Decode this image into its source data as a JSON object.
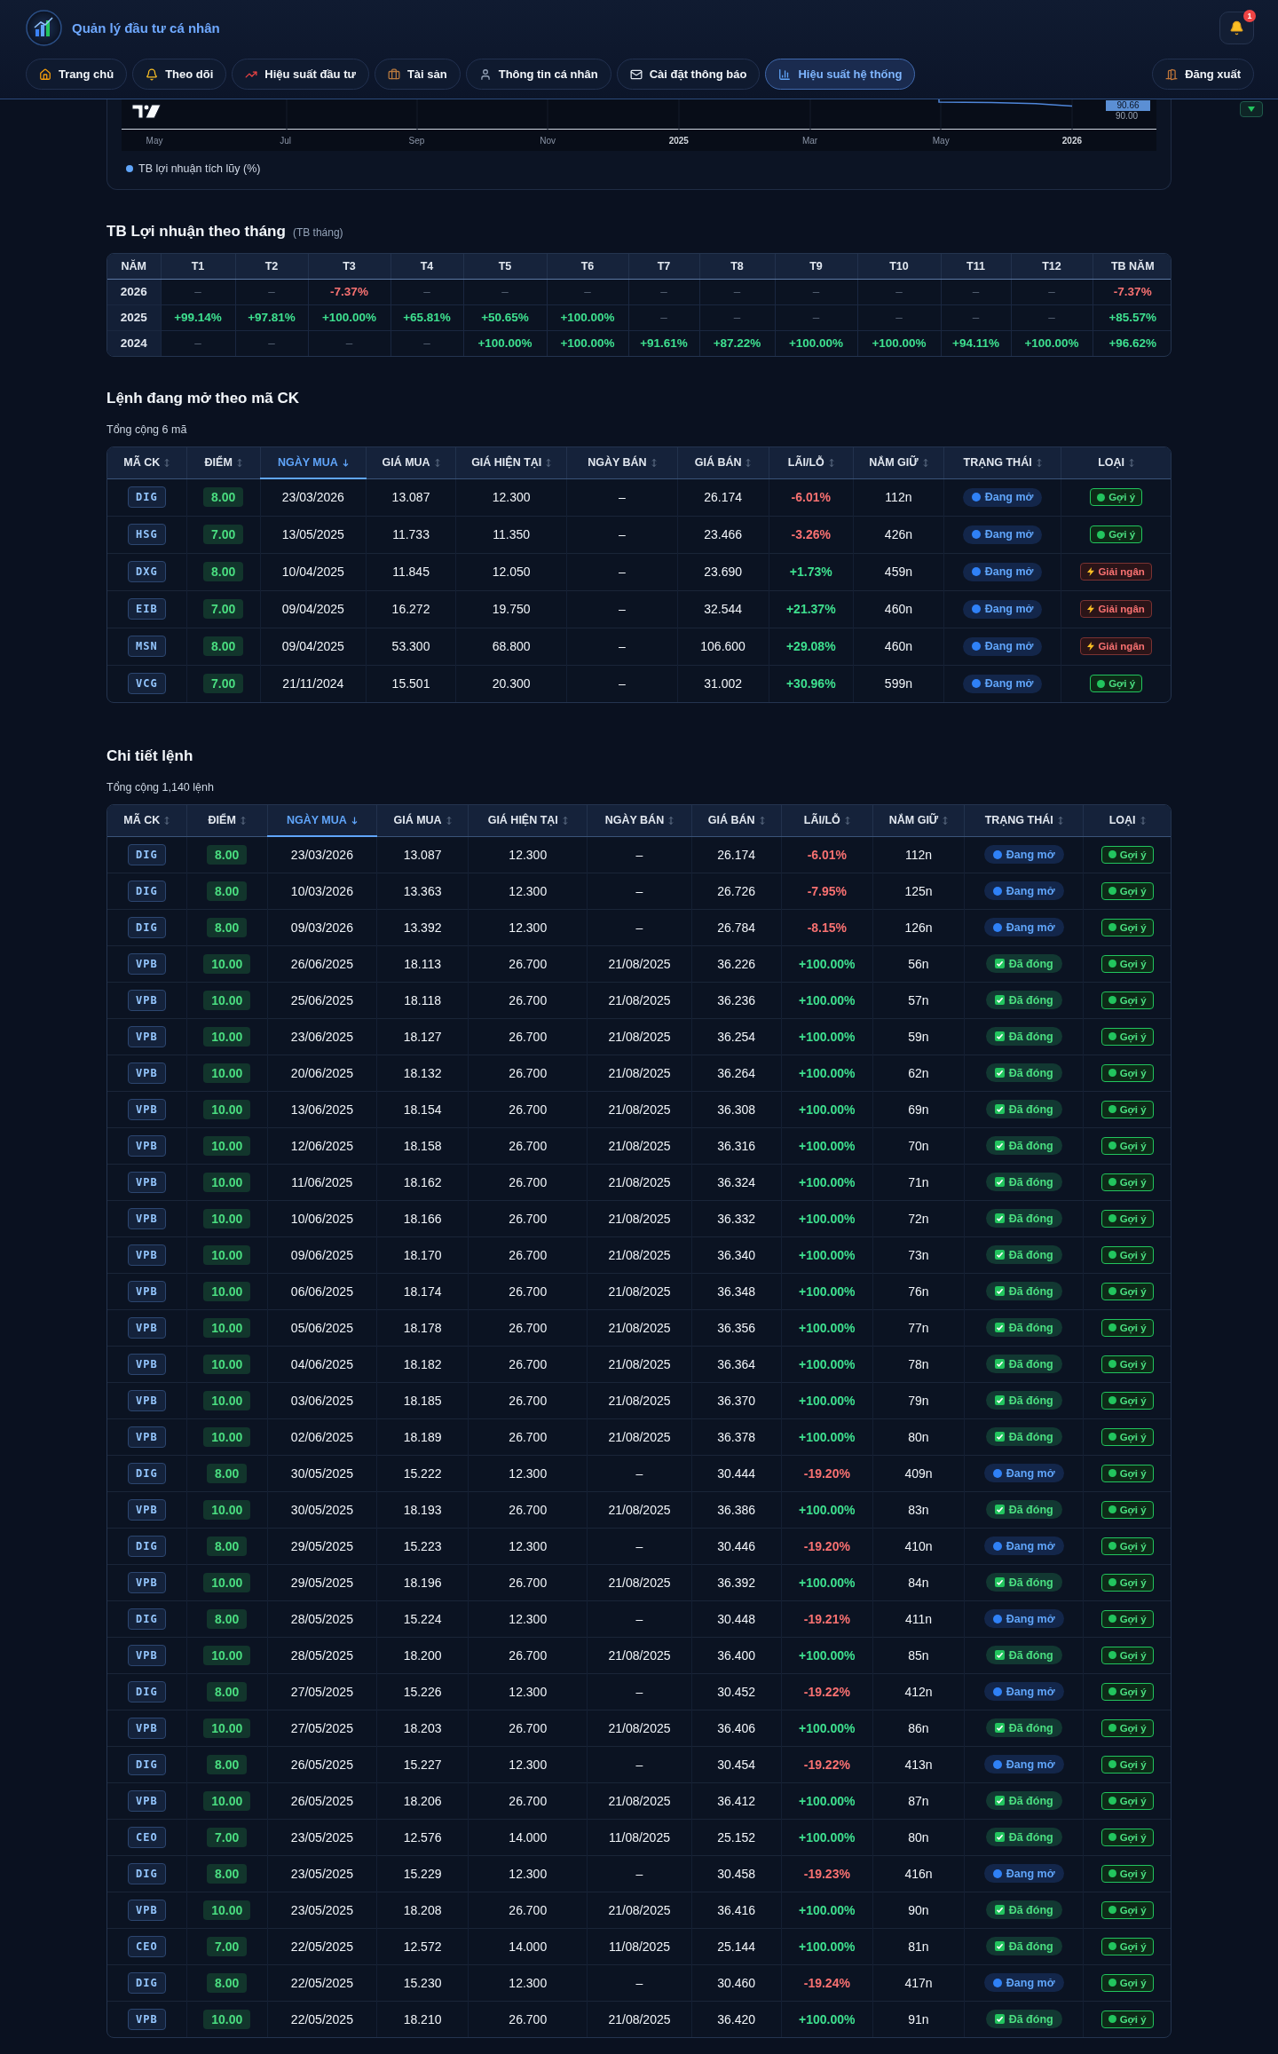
{
  "header": {
    "title": "Quản lý đầu tư cá nhân",
    "notification_count": "1"
  },
  "nav": {
    "tabs": [
      {
        "label": "Trang chủ",
        "selected": false
      },
      {
        "label": "Theo dõi",
        "selected": false
      },
      {
        "label": "Hiệu suất đầu tư",
        "selected": false
      },
      {
        "label": "Tài sản",
        "selected": false
      },
      {
        "label": "Thông tin cá nhân",
        "selected": false
      },
      {
        "label": "Cài đặt thông báo",
        "selected": false
      },
      {
        "label": "Hiệu suất hệ thống",
        "selected": true
      }
    ],
    "logout": "Đăng xuất"
  },
  "chart": {
    "price_label": "90.66",
    "y_labels": [
      "90.00"
    ],
    "x_labels": [
      {
        "text": "May",
        "kind": "month"
      },
      {
        "text": "Jul",
        "kind": "month"
      },
      {
        "text": "Sep",
        "kind": "month"
      },
      {
        "text": "Nov",
        "kind": "month"
      },
      {
        "text": "2025",
        "kind": "year"
      },
      {
        "text": "Mar",
        "kind": "month"
      },
      {
        "text": "May",
        "kind": "month"
      },
      {
        "text": "2026",
        "kind": "year"
      }
    ],
    "legend": "TB lợi nhuận tích lũy (%)"
  },
  "monthly_returns": {
    "title": "TB Lợi nhuận theo tháng",
    "subtitle": "(TB tháng)",
    "columns": [
      "NĂM",
      "T1",
      "T2",
      "T3",
      "T4",
      "T5",
      "T6",
      "T7",
      "T8",
      "T9",
      "T10",
      "T11",
      "T12",
      "TB NĂM"
    ],
    "rows": [
      {
        "year": "2026",
        "months": [
          {
            "value": "–",
            "kind": "empty"
          },
          {
            "value": "–",
            "kind": "empty"
          },
          {
            "value": "-7.37%",
            "kind": "loss"
          },
          {
            "value": "–",
            "kind": "empty"
          },
          {
            "value": "–",
            "kind": "empty"
          },
          {
            "value": "–",
            "kind": "empty"
          },
          {
            "value": "–",
            "kind": "empty"
          },
          {
            "value": "–",
            "kind": "empty"
          },
          {
            "value": "–",
            "kind": "empty"
          },
          {
            "value": "–",
            "kind": "empty"
          },
          {
            "value": "–",
            "kind": "empty"
          },
          {
            "value": "–",
            "kind": "empty"
          }
        ],
        "average": {
          "value": "-7.37%",
          "kind": "loss"
        }
      },
      {
        "year": "2025",
        "months": [
          {
            "value": "+99.14%",
            "kind": "gain"
          },
          {
            "value": "+97.81%",
            "kind": "gain"
          },
          {
            "value": "+100.00%",
            "kind": "gain"
          },
          {
            "value": "+65.81%",
            "kind": "gain"
          },
          {
            "value": "+50.65%",
            "kind": "gain"
          },
          {
            "value": "+100.00%",
            "kind": "gain"
          },
          {
            "value": "–",
            "kind": "empty"
          },
          {
            "value": "–",
            "kind": "empty"
          },
          {
            "value": "–",
            "kind": "empty"
          },
          {
            "value": "–",
            "kind": "empty"
          },
          {
            "value": "–",
            "kind": "empty"
          },
          {
            "value": "–",
            "kind": "empty"
          }
        ],
        "average": {
          "value": "+85.57%",
          "kind": "gain"
        }
      },
      {
        "year": "2024",
        "months": [
          {
            "value": "–",
            "kind": "empty"
          },
          {
            "value": "–",
            "kind": "empty"
          },
          {
            "value": "–",
            "kind": "empty"
          },
          {
            "value": "–",
            "kind": "empty"
          },
          {
            "value": "+100.00%",
            "kind": "gain"
          },
          {
            "value": "+100.00%",
            "kind": "gain"
          },
          {
            "value": "+91.61%",
            "kind": "gain"
          },
          {
            "value": "+87.22%",
            "kind": "gain"
          },
          {
            "value": "+100.00%",
            "kind": "gain"
          },
          {
            "value": "+100.00%",
            "kind": "gain"
          },
          {
            "value": "+94.11%",
            "kind": "gain"
          },
          {
            "value": "+100.00%",
            "kind": "gain"
          }
        ],
        "average": {
          "value": "+96.62%",
          "kind": "gain"
        }
      }
    ]
  },
  "open_orders": {
    "title": "Lệnh đang mở theo mã CK",
    "total": "Tổng cộng 6 mã",
    "columns": [
      {
        "label": "MÃ CK",
        "selected": false
      },
      {
        "label": "ĐIỂM",
        "selected": false
      },
      {
        "label": "NGÀY MUA",
        "selected": true
      },
      {
        "label": "GIÁ MUA",
        "selected": false
      },
      {
        "label": "GIÁ HIỆN TẠI",
        "selected": false
      },
      {
        "label": "NGÀY BÁN",
        "selected": false
      },
      {
        "label": "GIÁ BÁN",
        "selected": false
      },
      {
        "label": "LÃI/LỖ",
        "selected": false
      },
      {
        "label": "NẮM GIỮ",
        "selected": false
      },
      {
        "label": "TRẠNG THÁI",
        "selected": false
      },
      {
        "label": "LOẠI",
        "selected": false
      }
    ],
    "rows": [
      {
        "ticker": "DIG",
        "score": "8.00",
        "buy_date": "23/03/2026",
        "buy_price": "13.087",
        "current_price": "12.300",
        "sell_date": "–",
        "sell_price": "26.174",
        "pnl": {
          "value": "-6.01%",
          "kind": "loss"
        },
        "held": "112n",
        "status": {
          "label": "Đang mở",
          "kind": "open"
        },
        "type": {
          "label": "Gợi ý",
          "kind": "suggestion"
        }
      },
      {
        "ticker": "HSG",
        "score": "7.00",
        "buy_date": "13/05/2025",
        "buy_price": "11.733",
        "current_price": "11.350",
        "sell_date": "–",
        "sell_price": "23.466",
        "pnl": {
          "value": "-3.26%",
          "kind": "loss"
        },
        "held": "426n",
        "status": {
          "label": "Đang mở",
          "kind": "open"
        },
        "type": {
          "label": "Gợi ý",
          "kind": "suggestion"
        }
      },
      {
        "ticker": "DXG",
        "score": "8.00",
        "buy_date": "10/04/2025",
        "buy_price": "11.845",
        "current_price": "12.050",
        "sell_date": "–",
        "sell_price": "23.690",
        "pnl": {
          "value": "+1.73%",
          "kind": "gain"
        },
        "held": "459n",
        "status": {
          "label": "Đang mở",
          "kind": "open"
        },
        "type": {
          "label": "Giải ngân",
          "kind": "disbursement"
        }
      },
      {
        "ticker": "EIB",
        "score": "7.00",
        "buy_date": "09/04/2025",
        "buy_price": "16.272",
        "current_price": "19.750",
        "sell_date": "–",
        "sell_price": "32.544",
        "pnl": {
          "value": "+21.37%",
          "kind": "gain"
        },
        "held": "460n",
        "status": {
          "label": "Đang mở",
          "kind": "open"
        },
        "type": {
          "label": "Giải ngân",
          "kind": "disbursement"
        }
      },
      {
        "ticker": "MSN",
        "score": "8.00",
        "buy_date": "09/04/2025",
        "buy_price": "53.300",
        "current_price": "68.800",
        "sell_date": "–",
        "sell_price": "106.600",
        "pnl": {
          "value": "+29.08%",
          "kind": "gain"
        },
        "held": "460n",
        "status": {
          "label": "Đang mở",
          "kind": "open"
        },
        "type": {
          "label": "Giải ngân",
          "kind": "disbursement"
        }
      },
      {
        "ticker": "VCG",
        "score": "7.00",
        "buy_date": "21/11/2024",
        "buy_price": "15.501",
        "current_price": "20.300",
        "sell_date": "–",
        "sell_price": "31.002",
        "pnl": {
          "value": "+30.96%",
          "kind": "gain"
        },
        "held": "599n",
        "status": {
          "label": "Đang mở",
          "kind": "open"
        },
        "type": {
          "label": "Gợi ý",
          "kind": "suggestion"
        }
      }
    ]
  },
  "order_details": {
    "title": "Chi tiết lệnh",
    "total": "Tổng cộng 1,140 lệnh",
    "columns": [
      {
        "label": "MÃ CK",
        "selected": false
      },
      {
        "label": "ĐIỂM",
        "selected": false
      },
      {
        "label": "NGÀY MUA",
        "selected": true
      },
      {
        "label": "GIÁ MUA",
        "selected": false
      },
      {
        "label": "GIÁ HIỆN TẠI",
        "selected": false
      },
      {
        "label": "NGÀY BÁN",
        "selected": false
      },
      {
        "label": "GIÁ BÁN",
        "selected": false
      },
      {
        "label": "LÃI/LỖ",
        "selected": false
      },
      {
        "label": "NẮM GIỮ",
        "selected": false
      },
      {
        "label": "TRẠNG THÁI",
        "selected": false
      },
      {
        "label": "LOẠI",
        "selected": false
      }
    ],
    "rows": [
      {
        "ticker": "DIG",
        "score": "8.00",
        "buy_date": "23/03/2026",
        "buy_price": "13.087",
        "current_price": "12.300",
        "sell_date": "–",
        "sell_price": "26.174",
        "pnl": {
          "value": "-6.01%",
          "kind": "loss"
        },
        "held": "112n",
        "status": {
          "label": "Đang mở",
          "kind": "open"
        },
        "type": {
          "label": "Gợi ý",
          "kind": "suggestion"
        }
      },
      {
        "ticker": "DIG",
        "score": "8.00",
        "buy_date": "10/03/2026",
        "buy_price": "13.363",
        "current_price": "12.300",
        "sell_date": "–",
        "sell_price": "26.726",
        "pnl": {
          "value": "-7.95%",
          "kind": "loss"
        },
        "held": "125n",
        "status": {
          "label": "Đang mở",
          "kind": "open"
        },
        "type": {
          "label": "Gợi ý",
          "kind": "suggestion"
        }
      },
      {
        "ticker": "DIG",
        "score": "8.00",
        "buy_date": "09/03/2026",
        "buy_price": "13.392",
        "current_price": "12.300",
        "sell_date": "–",
        "sell_price": "26.784",
        "pnl": {
          "value": "-8.15%",
          "kind": "loss"
        },
        "held": "126n",
        "status": {
          "label": "Đang mở",
          "kind": "open"
        },
        "type": {
          "label": "Gợi ý",
          "kind": "suggestion"
        }
      },
      {
        "ticker": "VPB",
        "score": "10.00",
        "buy_date": "26/06/2025",
        "buy_price": "18.113",
        "current_price": "26.700",
        "sell_date": "21/08/2025",
        "sell_price": "36.226",
        "pnl": {
          "value": "+100.00%",
          "kind": "gain"
        },
        "held": "56n",
        "status": {
          "label": "Đã đóng",
          "kind": "closed"
        },
        "type": {
          "label": "Gợi ý",
          "kind": "suggestion"
        }
      },
      {
        "ticker": "VPB",
        "score": "10.00",
        "buy_date": "25/06/2025",
        "buy_price": "18.118",
        "current_price": "26.700",
        "sell_date": "21/08/2025",
        "sell_price": "36.236",
        "pnl": {
          "value": "+100.00%",
          "kind": "gain"
        },
        "held": "57n",
        "status": {
          "label": "Đã đóng",
          "kind": "closed"
        },
        "type": {
          "label": "Gợi ý",
          "kind": "suggestion"
        }
      },
      {
        "ticker": "VPB",
        "score": "10.00",
        "buy_date": "23/06/2025",
        "buy_price": "18.127",
        "current_price": "26.700",
        "sell_date": "21/08/2025",
        "sell_price": "36.254",
        "pnl": {
          "value": "+100.00%",
          "kind": "gain"
        },
        "held": "59n",
        "status": {
          "label": "Đã đóng",
          "kind": "closed"
        },
        "type": {
          "label": "Gợi ý",
          "kind": "suggestion"
        }
      },
      {
        "ticker": "VPB",
        "score": "10.00",
        "buy_date": "20/06/2025",
        "buy_price": "18.132",
        "current_price": "26.700",
        "sell_date": "21/08/2025",
        "sell_price": "36.264",
        "pnl": {
          "value": "+100.00%",
          "kind": "gain"
        },
        "held": "62n",
        "status": {
          "label": "Đã đóng",
          "kind": "closed"
        },
        "type": {
          "label": "Gợi ý",
          "kind": "suggestion"
        }
      },
      {
        "ticker": "VPB",
        "score": "10.00",
        "buy_date": "13/06/2025",
        "buy_price": "18.154",
        "current_price": "26.700",
        "sell_date": "21/08/2025",
        "sell_price": "36.308",
        "pnl": {
          "value": "+100.00%",
          "kind": "gain"
        },
        "held": "69n",
        "status": {
          "label": "Đã đóng",
          "kind": "closed"
        },
        "type": {
          "label": "Gợi ý",
          "kind": "suggestion"
        }
      },
      {
        "ticker": "VPB",
        "score": "10.00",
        "buy_date": "12/06/2025",
        "buy_price": "18.158",
        "current_price": "26.700",
        "sell_date": "21/08/2025",
        "sell_price": "36.316",
        "pnl": {
          "value": "+100.00%",
          "kind": "gain"
        },
        "held": "70n",
        "status": {
          "label": "Đã đóng",
          "kind": "closed"
        },
        "type": {
          "label": "Gợi ý",
          "kind": "suggestion"
        }
      },
      {
        "ticker": "VPB",
        "score": "10.00",
        "buy_date": "11/06/2025",
        "buy_price": "18.162",
        "current_price": "26.700",
        "sell_date": "21/08/2025",
        "sell_price": "36.324",
        "pnl": {
          "value": "+100.00%",
          "kind": "gain"
        },
        "held": "71n",
        "status": {
          "label": "Đã đóng",
          "kind": "closed"
        },
        "type": {
          "label": "Gợi ý",
          "kind": "suggestion"
        }
      },
      {
        "ticker": "VPB",
        "score": "10.00",
        "buy_date": "10/06/2025",
        "buy_price": "18.166",
        "current_price": "26.700",
        "sell_date": "21/08/2025",
        "sell_price": "36.332",
        "pnl": {
          "value": "+100.00%",
          "kind": "gain"
        },
        "held": "72n",
        "status": {
          "label": "Đã đóng",
          "kind": "closed"
        },
        "type": {
          "label": "Gợi ý",
          "kind": "suggestion"
        }
      },
      {
        "ticker": "VPB",
        "score": "10.00",
        "buy_date": "09/06/2025",
        "buy_price": "18.170",
        "current_price": "26.700",
        "sell_date": "21/08/2025",
        "sell_price": "36.340",
        "pnl": {
          "value": "+100.00%",
          "kind": "gain"
        },
        "held": "73n",
        "status": {
          "label": "Đã đóng",
          "kind": "closed"
        },
        "type": {
          "label": "Gợi ý",
          "kind": "suggestion"
        }
      },
      {
        "ticker": "VPB",
        "score": "10.00",
        "buy_date": "06/06/2025",
        "buy_price": "18.174",
        "current_price": "26.700",
        "sell_date": "21/08/2025",
        "sell_price": "36.348",
        "pnl": {
          "value": "+100.00%",
          "kind": "gain"
        },
        "held": "76n",
        "status": {
          "label": "Đã đóng",
          "kind": "closed"
        },
        "type": {
          "label": "Gợi ý",
          "kind": "suggestion"
        }
      },
      {
        "ticker": "VPB",
        "score": "10.00",
        "buy_date": "05/06/2025",
        "buy_price": "18.178",
        "current_price": "26.700",
        "sell_date": "21/08/2025",
        "sell_price": "36.356",
        "pnl": {
          "value": "+100.00%",
          "kind": "gain"
        },
        "held": "77n",
        "status": {
          "label": "Đã đóng",
          "kind": "closed"
        },
        "type": {
          "label": "Gợi ý",
          "kind": "suggestion"
        }
      },
      {
        "ticker": "VPB",
        "score": "10.00",
        "buy_date": "04/06/2025",
        "buy_price": "18.182",
        "current_price": "26.700",
        "sell_date": "21/08/2025",
        "sell_price": "36.364",
        "pnl": {
          "value": "+100.00%",
          "kind": "gain"
        },
        "held": "78n",
        "status": {
          "label": "Đã đóng",
          "kind": "closed"
        },
        "type": {
          "label": "Gợi ý",
          "kind": "suggestion"
        }
      },
      {
        "ticker": "VPB",
        "score": "10.00",
        "buy_date": "03/06/2025",
        "buy_price": "18.185",
        "current_price": "26.700",
        "sell_date": "21/08/2025",
        "sell_price": "36.370",
        "pnl": {
          "value": "+100.00%",
          "kind": "gain"
        },
        "held": "79n",
        "status": {
          "label": "Đã đóng",
          "kind": "closed"
        },
        "type": {
          "label": "Gợi ý",
          "kind": "suggestion"
        }
      },
      {
        "ticker": "VPB",
        "score": "10.00",
        "buy_date": "02/06/2025",
        "buy_price": "18.189",
        "current_price": "26.700",
        "sell_date": "21/08/2025",
        "sell_price": "36.378",
        "pnl": {
          "value": "+100.00%",
          "kind": "gain"
        },
        "held": "80n",
        "status": {
          "label": "Đã đóng",
          "kind": "closed"
        },
        "type": {
          "label": "Gợi ý",
          "kind": "suggestion"
        }
      },
      {
        "ticker": "DIG",
        "score": "8.00",
        "buy_date": "30/05/2025",
        "buy_price": "15.222",
        "current_price": "12.300",
        "sell_date": "–",
        "sell_price": "30.444",
        "pnl": {
          "value": "-19.20%",
          "kind": "loss"
        },
        "held": "409n",
        "status": {
          "label": "Đang mở",
          "kind": "open"
        },
        "type": {
          "label": "Gợi ý",
          "kind": "suggestion"
        }
      },
      {
        "ticker": "VPB",
        "score": "10.00",
        "buy_date": "30/05/2025",
        "buy_price": "18.193",
        "current_price": "26.700",
        "sell_date": "21/08/2025",
        "sell_price": "36.386",
        "pnl": {
          "value": "+100.00%",
          "kind": "gain"
        },
        "held": "83n",
        "status": {
          "label": "Đã đóng",
          "kind": "closed"
        },
        "type": {
          "label": "Gợi ý",
          "kind": "suggestion"
        }
      },
      {
        "ticker": "DIG",
        "score": "8.00",
        "buy_date": "29/05/2025",
        "buy_price": "15.223",
        "current_price": "12.300",
        "sell_date": "–",
        "sell_price": "30.446",
        "pnl": {
          "value": "-19.20%",
          "kind": "loss"
        },
        "held": "410n",
        "status": {
          "label": "Đang mở",
          "kind": "open"
        },
        "type": {
          "label": "Gợi ý",
          "kind": "suggestion"
        }
      },
      {
        "ticker": "VPB",
        "score": "10.00",
        "buy_date": "29/05/2025",
        "buy_price": "18.196",
        "current_price": "26.700",
        "sell_date": "21/08/2025",
        "sell_price": "36.392",
        "pnl": {
          "value": "+100.00%",
          "kind": "gain"
        },
        "held": "84n",
        "status": {
          "label": "Đã đóng",
          "kind": "closed"
        },
        "type": {
          "label": "Gợi ý",
          "kind": "suggestion"
        }
      },
      {
        "ticker": "DIG",
        "score": "8.00",
        "buy_date": "28/05/2025",
        "buy_price": "15.224",
        "current_price": "12.300",
        "sell_date": "–",
        "sell_price": "30.448",
        "pnl": {
          "value": "-19.21%",
          "kind": "loss"
        },
        "held": "411n",
        "status": {
          "label": "Đang mở",
          "kind": "open"
        },
        "type": {
          "label": "Gợi ý",
          "kind": "suggestion"
        }
      },
      {
        "ticker": "VPB",
        "score": "10.00",
        "buy_date": "28/05/2025",
        "buy_price": "18.200",
        "current_price": "26.700",
        "sell_date": "21/08/2025",
        "sell_price": "36.400",
        "pnl": {
          "value": "+100.00%",
          "kind": "gain"
        },
        "held": "85n",
        "status": {
          "label": "Đã đóng",
          "kind": "closed"
        },
        "type": {
          "label": "Gợi ý",
          "kind": "suggestion"
        }
      },
      {
        "ticker": "DIG",
        "score": "8.00",
        "buy_date": "27/05/2025",
        "buy_price": "15.226",
        "current_price": "12.300",
        "sell_date": "–",
        "sell_price": "30.452",
        "pnl": {
          "value": "-19.22%",
          "kind": "loss"
        },
        "held": "412n",
        "status": {
          "label": "Đang mở",
          "kind": "open"
        },
        "type": {
          "label": "Gợi ý",
          "kind": "suggestion"
        }
      },
      {
        "ticker": "VPB",
        "score": "10.00",
        "buy_date": "27/05/2025",
        "buy_price": "18.203",
        "current_price": "26.700",
        "sell_date": "21/08/2025",
        "sell_price": "36.406",
        "pnl": {
          "value": "+100.00%",
          "kind": "gain"
        },
        "held": "86n",
        "status": {
          "label": "Đã đóng",
          "kind": "closed"
        },
        "type": {
          "label": "Gợi ý",
          "kind": "suggestion"
        }
      },
      {
        "ticker": "DIG",
        "score": "8.00",
        "buy_date": "26/05/2025",
        "buy_price": "15.227",
        "current_price": "12.300",
        "sell_date": "–",
        "sell_price": "30.454",
        "pnl": {
          "value": "-19.22%",
          "kind": "loss"
        },
        "held": "413n",
        "status": {
          "label": "Đang mở",
          "kind": "open"
        },
        "type": {
          "label": "Gợi ý",
          "kind": "suggestion"
        }
      },
      {
        "ticker": "VPB",
        "score": "10.00",
        "buy_date": "26/05/2025",
        "buy_price": "18.206",
        "current_price": "26.700",
        "sell_date": "21/08/2025",
        "sell_price": "36.412",
        "pnl": {
          "value": "+100.00%",
          "kind": "gain"
        },
        "held": "87n",
        "status": {
          "label": "Đã đóng",
          "kind": "closed"
        },
        "type": {
          "label": "Gợi ý",
          "kind": "suggestion"
        }
      },
      {
        "ticker": "CEO",
        "score": "7.00",
        "buy_date": "23/05/2025",
        "buy_price": "12.576",
        "current_price": "14.000",
        "sell_date": "11/08/2025",
        "sell_price": "25.152",
        "pnl": {
          "value": "+100.00%",
          "kind": "gain"
        },
        "held": "80n",
        "status": {
          "label": "Đã đóng",
          "kind": "closed"
        },
        "type": {
          "label": "Gợi ý",
          "kind": "suggestion"
        }
      },
      {
        "ticker": "DIG",
        "score": "8.00",
        "buy_date": "23/05/2025",
        "buy_price": "15.229",
        "current_price": "12.300",
        "sell_date": "–",
        "sell_price": "30.458",
        "pnl": {
          "value": "-19.23%",
          "kind": "loss"
        },
        "held": "416n",
        "status": {
          "label": "Đang mở",
          "kind": "open"
        },
        "type": {
          "label": "Gợi ý",
          "kind": "suggestion"
        }
      },
      {
        "ticker": "VPB",
        "score": "10.00",
        "buy_date": "23/05/2025",
        "buy_price": "18.208",
        "current_price": "26.700",
        "sell_date": "21/08/2025",
        "sell_price": "36.416",
        "pnl": {
          "value": "+100.00%",
          "kind": "gain"
        },
        "held": "90n",
        "status": {
          "label": "Đã đóng",
          "kind": "closed"
        },
        "type": {
          "label": "Gợi ý",
          "kind": "suggestion"
        }
      },
      {
        "ticker": "CEO",
        "score": "7.00",
        "buy_date": "22/05/2025",
        "buy_price": "12.572",
        "current_price": "14.000",
        "sell_date": "11/08/2025",
        "sell_price": "25.144",
        "pnl": {
          "value": "+100.00%",
          "kind": "gain"
        },
        "held": "81n",
        "status": {
          "label": "Đã đóng",
          "kind": "closed"
        },
        "type": {
          "label": "Gợi ý",
          "kind": "suggestion"
        }
      },
      {
        "ticker": "DIG",
        "score": "8.00",
        "buy_date": "22/05/2025",
        "buy_price": "15.230",
        "current_price": "12.300",
        "sell_date": "–",
        "sell_price": "30.460",
        "pnl": {
          "value": "-19.24%",
          "kind": "loss"
        },
        "held": "417n",
        "status": {
          "label": "Đang mở",
          "kind": "open"
        },
        "type": {
          "label": "Gợi ý",
          "kind": "suggestion"
        }
      },
      {
        "ticker": "VPB",
        "score": "10.00",
        "buy_date": "22/05/2025",
        "buy_price": "18.210",
        "current_price": "26.700",
        "sell_date": "21/08/2025",
        "sell_price": "36.420",
        "pnl": {
          "value": "+100.00%",
          "kind": "gain"
        },
        "held": "91n",
        "status": {
          "label": "Đã đóng",
          "kind": "closed"
        },
        "type": {
          "label": "Gợi ý",
          "kind": "suggestion"
        }
      }
    ]
  }
}
